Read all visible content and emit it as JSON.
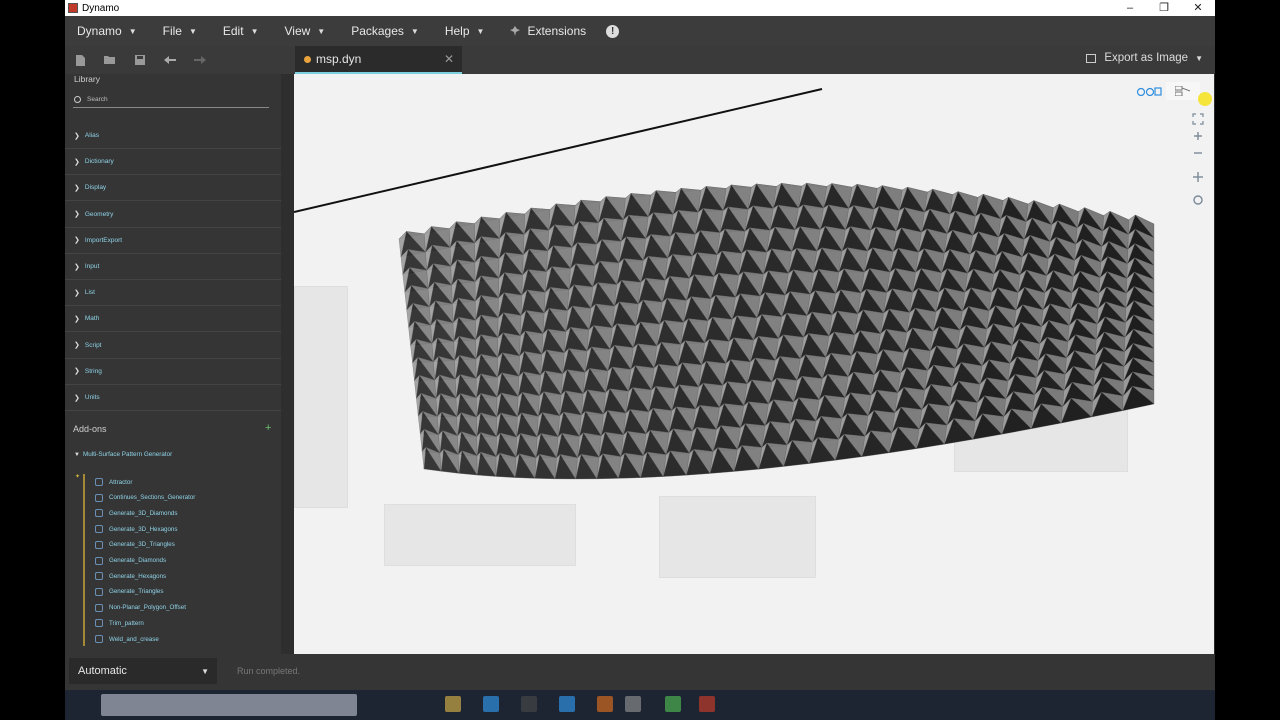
{
  "window": {
    "title": "Dynamo",
    "min": "–",
    "restore": "❐",
    "close": "✕"
  },
  "menu": [
    {
      "label": "Dynamo",
      "caret": "▼"
    },
    {
      "label": "File",
      "caret": "▼"
    },
    {
      "label": "Edit",
      "caret": "▼"
    },
    {
      "label": "View",
      "caret": "▼"
    },
    {
      "label": "Packages",
      "caret": "▼"
    },
    {
      "label": "Help",
      "caret": "▼"
    },
    {
      "label": "Extensions",
      "caret": ""
    }
  ],
  "info_icon": "!",
  "toolbar": {
    "icons": [
      "new-file-icon",
      "open-folder-icon",
      "save-icon",
      "undo-icon",
      "redo-icon"
    ]
  },
  "tab": {
    "label": "msp.dyn",
    "close": "✕"
  },
  "export": {
    "label": "Export as Image",
    "caret": "▼"
  },
  "library": {
    "title": "Library",
    "search_placeholder": "Search",
    "categories": [
      "Alias",
      "Dictionary",
      "Display",
      "Geometry",
      "ImportExport",
      "Input",
      "List",
      "Math",
      "Script",
      "String",
      "Units"
    ]
  },
  "addons": {
    "title": "Add-ons",
    "plus": "+",
    "package": "Multi-Surface Pattern Generator",
    "nodes": [
      "Attractor",
      "Continues_Sections_Generator",
      "Generate_3D_Diamonds",
      "Generate_3D_Hexagons",
      "Generate_3D_Triangles",
      "Generate_Diamonds",
      "Generate_Hexagons",
      "Generate_Triangles",
      "Non-Planar_Polygon_Offset",
      "Trim_pattern",
      "Weld_and_crease"
    ]
  },
  "bottom": {
    "run_mode": "Automatic",
    "status": "Run completed."
  },
  "colors": {
    "accent": "#7ecfe0",
    "tab_dot": "#e8a33c",
    "label": "#8fd3e8"
  }
}
